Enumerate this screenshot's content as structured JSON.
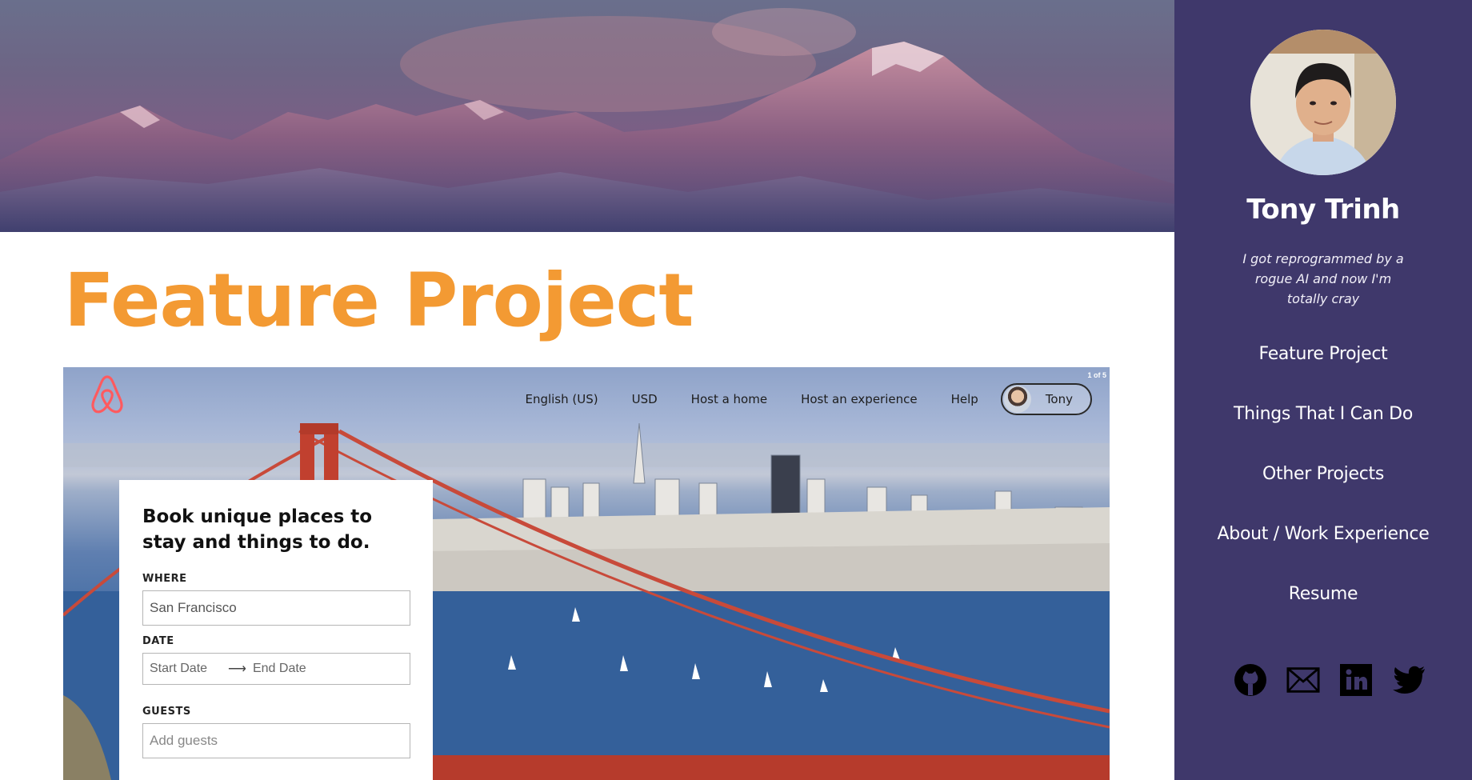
{
  "main": {
    "page_title": "Feature Project"
  },
  "feature_screenshot": {
    "nav": {
      "language": "English (US)",
      "currency": "USD",
      "host_home": "Host a home",
      "host_experience": "Host an experience",
      "help": "Help",
      "user": "Tony"
    },
    "counter": "1 of 5",
    "booking": {
      "heading_line1": "Book unique places to",
      "heading_line2": "stay and things to do.",
      "where_label": "WHERE",
      "where_value": "San Francisco",
      "date_label": "DATE",
      "start_placeholder": "Start Date",
      "end_placeholder": "End Date",
      "guests_label": "GUESTS",
      "guests_placeholder": "Add guests"
    },
    "brand_color": "#ff5a5f"
  },
  "sidebar": {
    "name": "Tony Trinh",
    "tagline": "I got reprogrammed by a rogue AI and now I'm totally cray",
    "nav": [
      {
        "label": "Feature Project"
      },
      {
        "label": "Things That I Can Do"
      },
      {
        "label": "Other Projects"
      },
      {
        "label": "About / Work Experience"
      },
      {
        "label": "Resume"
      }
    ],
    "social_icons": [
      "github-icon",
      "mail-icon",
      "linkedin-icon",
      "twitter-icon"
    ],
    "background_color": "#3f386b"
  },
  "colors": {
    "title_orange": "#f39a33",
    "sidebar_bg": "#3f386b"
  }
}
